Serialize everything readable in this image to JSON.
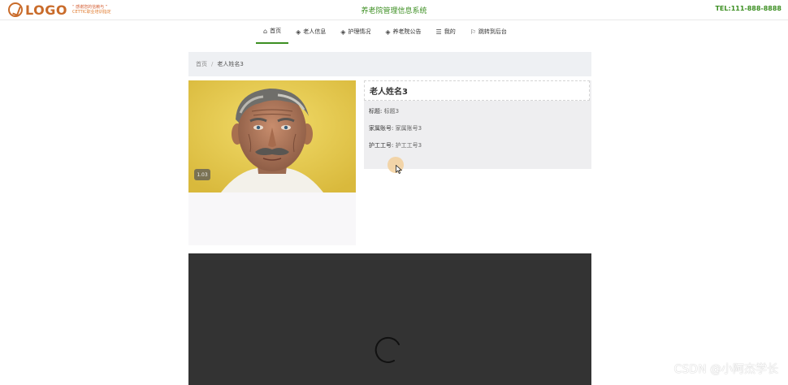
{
  "header": {
    "logo_text": "LOGO",
    "logo_sub_line1": "“ 感谢您的信赖与 ”",
    "logo_sub_line2": "CETTIC职业培训指定",
    "system_title": "养老院管理信息系统",
    "tel": "TEL:111-888-8888"
  },
  "nav": {
    "items": [
      {
        "label": "首页",
        "icon": "home-icon",
        "active": true
      },
      {
        "label": "老人信息",
        "icon": "cube-icon",
        "active": false
      },
      {
        "label": "护理情况",
        "icon": "cube-icon",
        "active": false
      },
      {
        "label": "养老院公告",
        "icon": "cube-icon",
        "active": false
      },
      {
        "label": "我的",
        "icon": "list-icon",
        "active": false
      },
      {
        "label": "跳转到后台",
        "icon": "flag-icon",
        "active": false
      }
    ]
  },
  "breadcrumb": {
    "home": "首页",
    "separator": "/",
    "current": "老人姓名3"
  },
  "image": {
    "badge": "1.03"
  },
  "detail": {
    "name": "老人姓名3",
    "rows": [
      {
        "label": "标题:",
        "value": "标题3"
      },
      {
        "label": "家属账号:",
        "value": "家属账号3"
      },
      {
        "label": "护工工号:",
        "value": "护工工号3"
      }
    ]
  },
  "watermark": "CSDN @小阿杰学长",
  "colors": {
    "accent_green": "#3c8f22",
    "logo_orange": "#c96b2a",
    "video_bg": "#333333",
    "breadcrumb_bg": "#eef0f3"
  }
}
